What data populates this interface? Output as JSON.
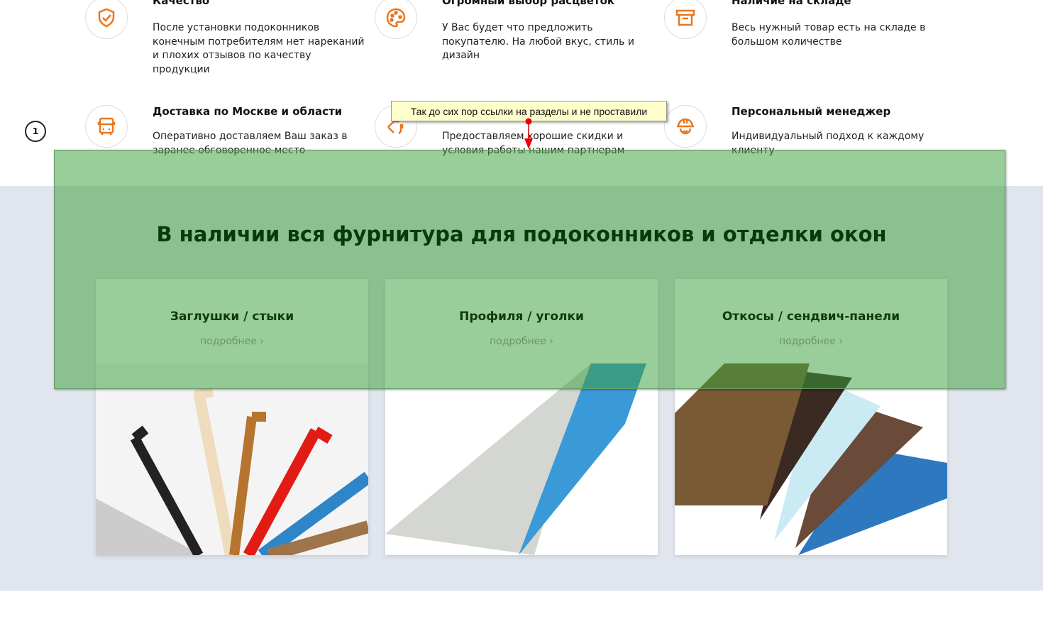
{
  "features": [
    {
      "title": "Качество",
      "text": "После установки подоконников конечным потребителям нет нареканий и плохих отзывов по качеству продукции",
      "icon": "shield-check-icon"
    },
    {
      "title": "Огромный выбор расцветок",
      "text": "У Вас будет что предложить покупателю. На любой вкус, стиль и дизайн",
      "icon": "palette-icon"
    },
    {
      "title": "Наличие на складе",
      "text": "Весь нужный товар есть на складе в большом количестве",
      "icon": "archive-box-icon"
    },
    {
      "title": "Доставка по Москве и области",
      "text": "Оперативно доставляем Ваш заказ в заранее обговоренное место",
      "icon": "bus-icon"
    },
    {
      "title": "",
      "text": "Предоставляем хорошие скидки и условия работы нашим партнерам",
      "icon": "tag-icon"
    },
    {
      "title": "Персональный менеджер",
      "text": "Индивидуальный подход к каждому клиенту",
      "icon": "helmet-icon"
    }
  ],
  "section": {
    "title": "В наличии вся фурнитура для подоконников и отделки окон"
  },
  "cards": [
    {
      "title": "Заглушки / стыки",
      "link": "подробнее"
    },
    {
      "title": "Профиля / уголки",
      "link": "подробнее"
    },
    {
      "title": "Откосы / сендвич-панели",
      "link": "подробнее"
    }
  ],
  "annotation": {
    "marker": "1",
    "comment": "Так до сих пор ссылки на разделы и не проставили"
  },
  "colors": {
    "accent": "#e87722",
    "overlay": "#99cc99",
    "section_bg": "#e1e6ee"
  }
}
